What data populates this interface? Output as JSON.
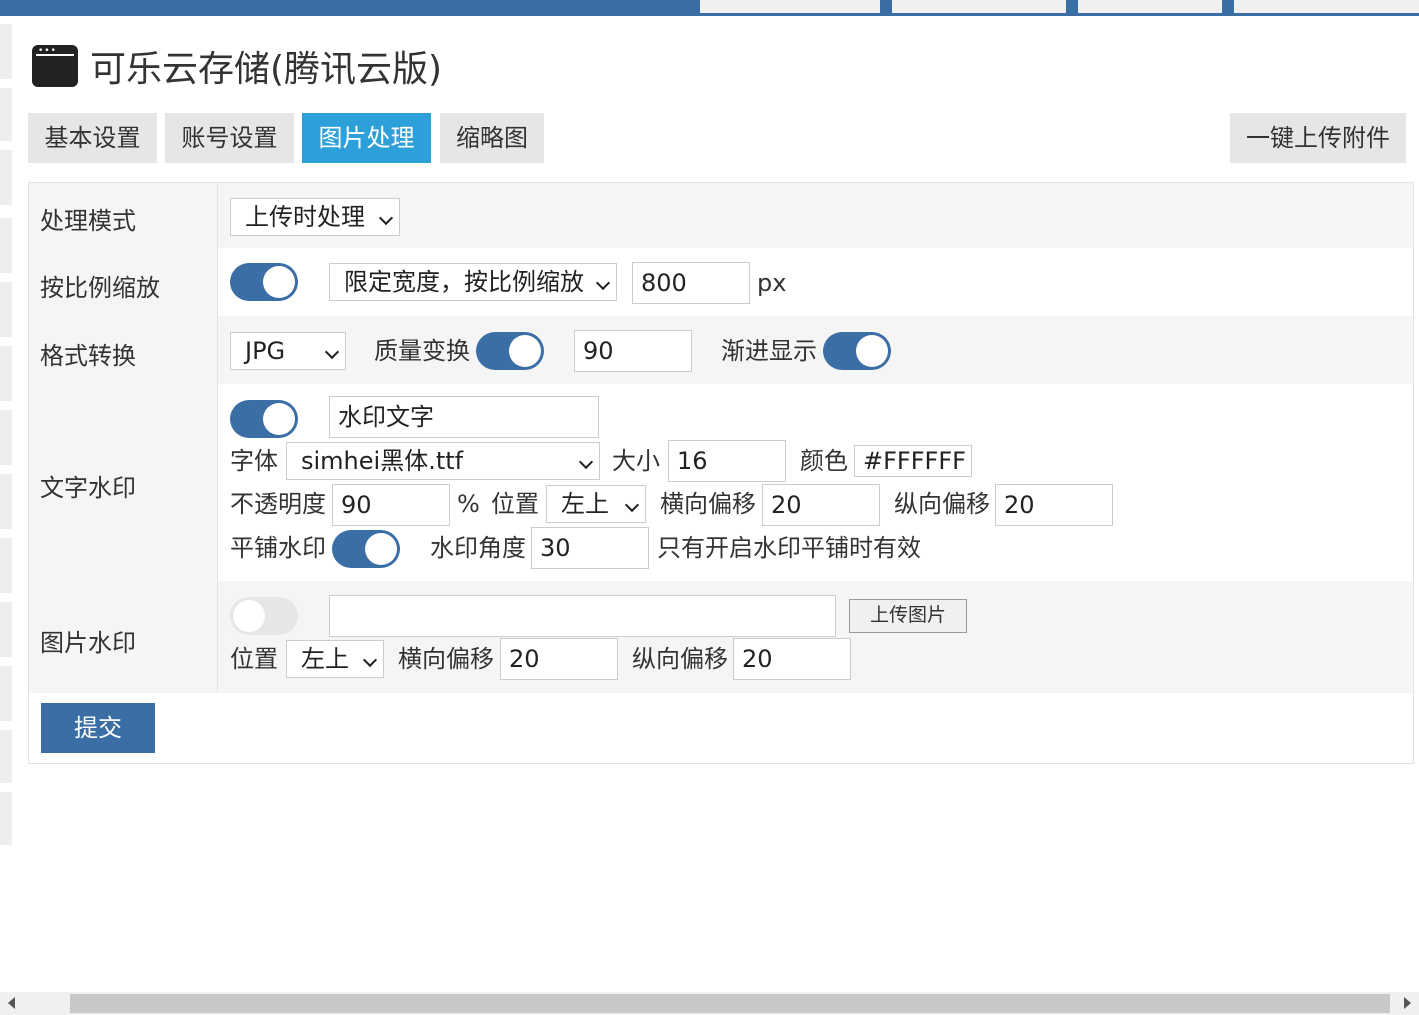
{
  "colors": {
    "primary": "#3a6ea5",
    "active_tab": "#2ea0d9",
    "tab_bg": "#e6e6e6",
    "row_alt": "#f5f5f5"
  },
  "page": {
    "title": "可乐云存储(腾讯云版)",
    "title_icon": "browser-window-icon"
  },
  "tabs": [
    {
      "label": "基本设置",
      "active": false
    },
    {
      "label": "账号设置",
      "active": false
    },
    {
      "label": "图片处理",
      "active": true
    },
    {
      "label": "缩略图",
      "active": false
    }
  ],
  "upload_all_label": "一键上传附件",
  "form": {
    "mode": {
      "label": "处理模式",
      "value": "上传时处理"
    },
    "scale": {
      "label": "按比例缩放",
      "enabled": true,
      "mode_value": "限定宽度，按比例缩放",
      "size": "800",
      "unit": "px"
    },
    "format": {
      "label": "格式转换",
      "value": "JPG",
      "quality_label": "质量变换",
      "quality_enabled": true,
      "quality": "90",
      "progressive_label": "渐进显示",
      "progressive_enabled": true
    },
    "text_wm": {
      "label": "文字水印",
      "enabled": true,
      "text": "水印文字",
      "font_label": "字体",
      "font": "simhei黑体.ttf",
      "size_label": "大小",
      "size": "16",
      "color_label": "颜色",
      "color": "#FFFFFF",
      "opacity_label": "不透明度",
      "opacity": "90",
      "percent": "%",
      "pos_label": "位置",
      "pos": "左上",
      "offset_x_label": "横向偏移",
      "offset_x": "20",
      "offset_y_label": "纵向偏移",
      "offset_y": "20",
      "tile_label": "平铺水印",
      "tile_enabled": true,
      "angle_label": "水印角度",
      "angle": "30",
      "angle_note": "只有开启水印平铺时有效"
    },
    "image_wm": {
      "label": "图片水印",
      "enabled": false,
      "path": "",
      "upload_label": "上传图片",
      "pos_label": "位置",
      "pos": "左上",
      "offset_x_label": "横向偏移",
      "offset_x": "20",
      "offset_y_label": "纵向偏移",
      "offset_y": "20"
    },
    "submit_label": "提交"
  }
}
